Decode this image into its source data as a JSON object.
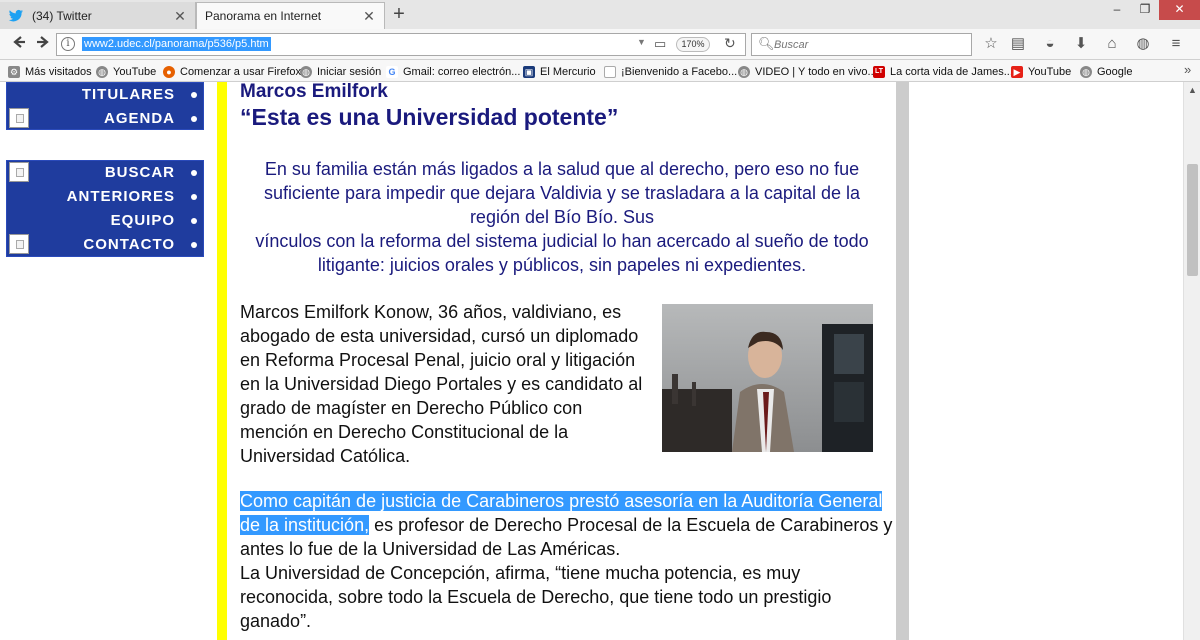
{
  "tabs": [
    {
      "label": "(34) Twitter",
      "icon": "twitter-bird-icon",
      "active": false
    },
    {
      "label": "Panorama en Internet",
      "icon": "none",
      "active": true
    }
  ],
  "window_controls": {
    "minimize": "–",
    "maximize": "❐",
    "close": "✕"
  },
  "navbar": {
    "url": "www2.udec.cl/panorama/p536/p5.htm",
    "zoom": "170%",
    "search_placeholder": "Buscar"
  },
  "bookmarks": [
    {
      "label": "Más visitados",
      "icon": "gear-icon",
      "color": "#777777"
    },
    {
      "label": "YouTube",
      "icon": "globe-icon",
      "color": "#777777"
    },
    {
      "label": "Comenzar a usar Firefox",
      "icon": "firefox-icon",
      "color": "#e66000"
    },
    {
      "label": "Iniciar sesión",
      "icon": "globe-icon",
      "color": "#777777"
    },
    {
      "label": "Gmail: correo electrón...",
      "icon": "google-icon",
      "color": "#4285f4"
    },
    {
      "label": "El Mercurio",
      "icon": "mercurio-icon",
      "color": "#1a3a7a"
    },
    {
      "label": "¡Bienvenido a Facebo...",
      "icon": "page-icon",
      "color": "#999999"
    },
    {
      "label": "VIDEO | Y todo en vivo...",
      "icon": "globe-icon",
      "color": "#777777"
    },
    {
      "label": "La corta vida de James...",
      "icon": "lt-icon",
      "color": "#d00000"
    },
    {
      "label": "YouTube",
      "icon": "youtube-icon",
      "color": "#e62117"
    },
    {
      "label": "Google",
      "icon": "globe-icon",
      "color": "#777777"
    }
  ],
  "menu": {
    "top": [
      "TITULARES",
      "AGENDA"
    ],
    "bottom": [
      "BUSCAR",
      "ANTERIORES",
      "EQUIPO",
      "CONTACTO"
    ]
  },
  "article": {
    "author": "Marcos Emilfork",
    "headline": "“Esta es una Universidad potente”",
    "lead_1": "En su familia están más ligados a la salud que al derecho, pero eso no fue suficiente para impedir que dejara Valdivia y se trasladara a la capital de la región del Bío Bío. Sus",
    "lead_2": "vínculos con la reforma del sistema judicial lo han acercado al sueño de todo litigante: juicios orales y públicos, sin papeles ni expedientes.",
    "para_1": "Marcos Emilfork Konow, 36 años, valdiviano, es abogado de esta universidad, cursó un diplomado en Reforma Procesal Penal, juicio oral y litigación en la Universidad Diego Portales y es candidato al grado de magíster en Derecho Público con mención en Derecho Constitucional de la Universidad Católica.",
    "para_2_highlight": "Como capitán de justicia de Carabineros prestó asesoría en la Auditoría General de la institución,",
    "para_2_rest": " es profesor de Derecho Procesal de la Escuela de Carabineros y antes lo fue de la Universidad de Las Américas.",
    "para_3": "La Universidad de Concepción, afirma, “tiene mucha potencia, es muy reconocida, sobre todo la Escuela de Derecho, que tiene todo un prestigio ganado”."
  },
  "colors": {
    "menu_blue": "#1f3c9e",
    "title_navy": "#1a1a7d",
    "accent_yellow": "#ffff00",
    "selection_blue": "#3399ff"
  }
}
